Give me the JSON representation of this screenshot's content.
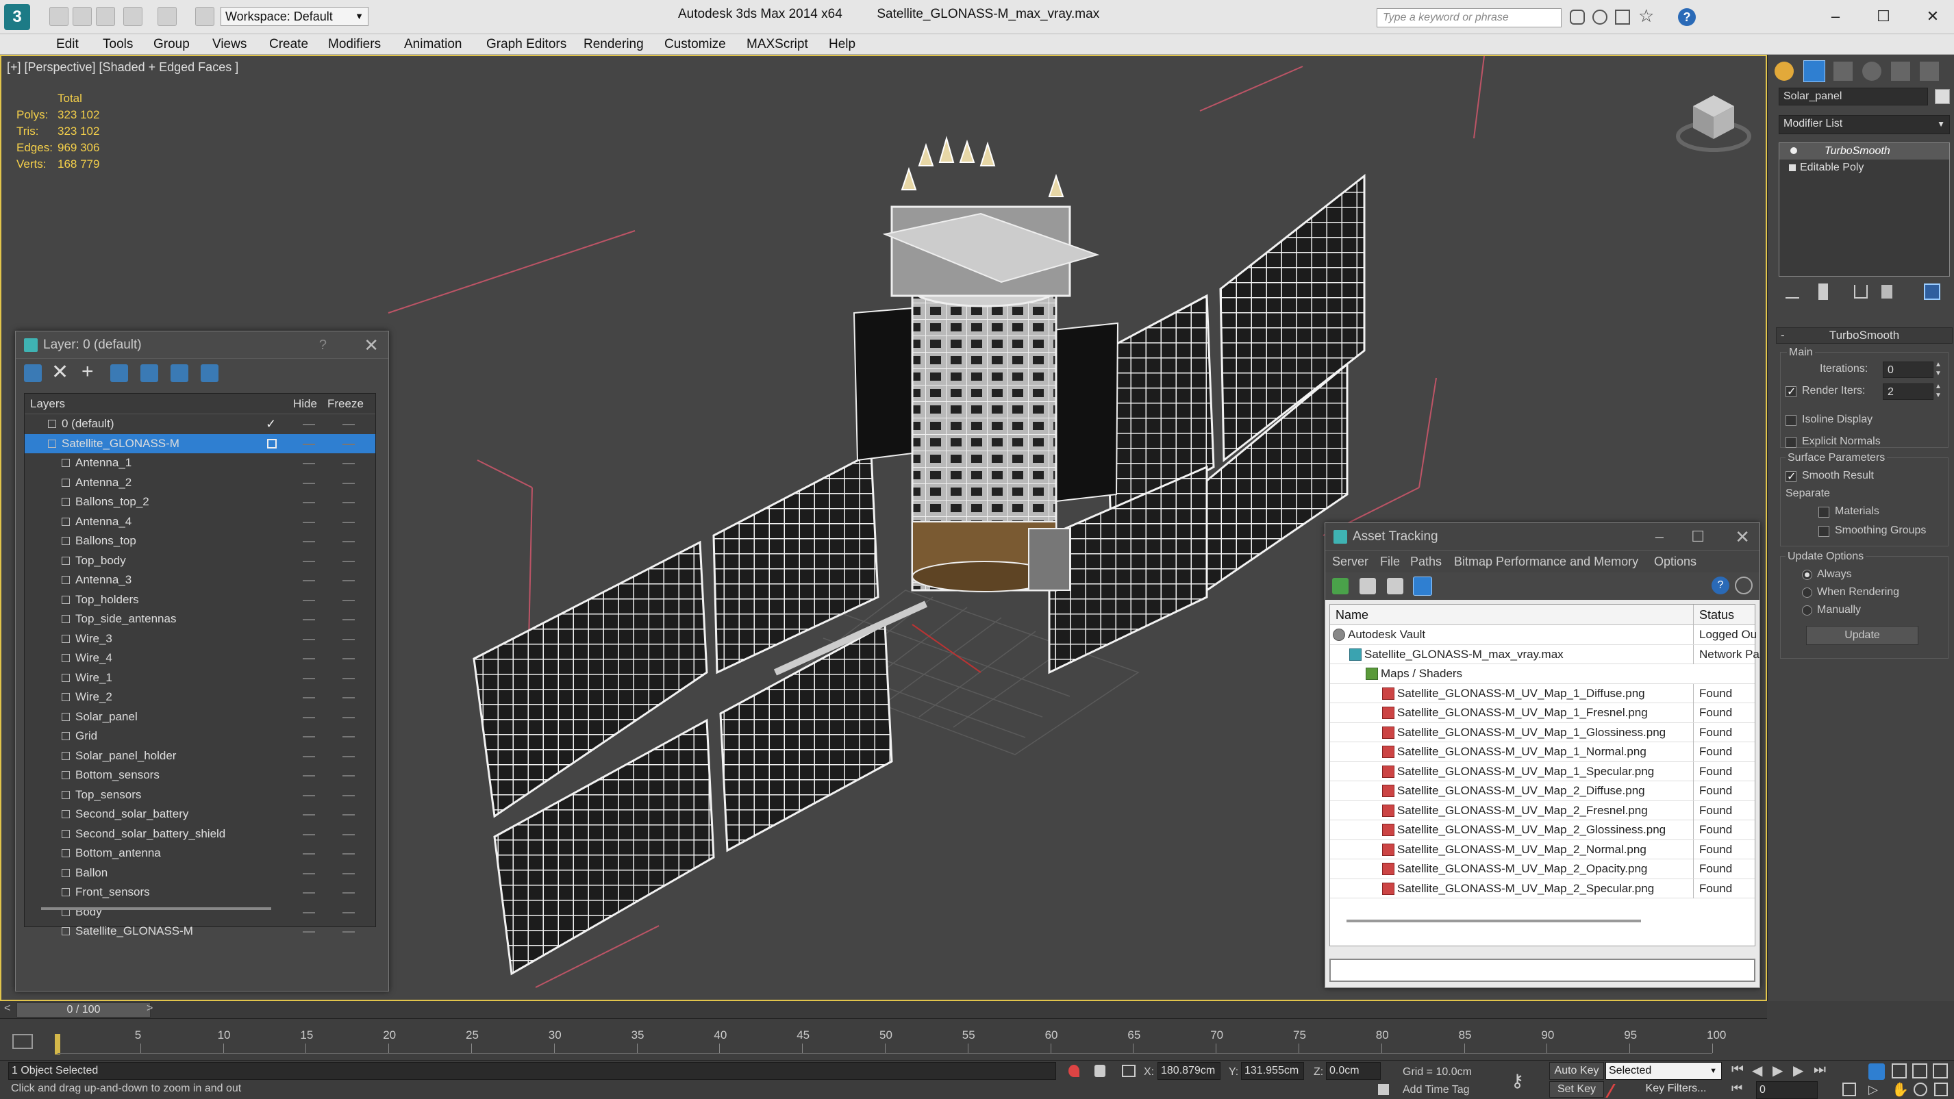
{
  "app": {
    "title": "Autodesk 3ds Max  2014 x64",
    "file": "Satellite_GLONASS-M_max_vray.max",
    "workspace": "Workspace: Default",
    "search_placeholder": "Type a keyword or phrase"
  },
  "menu": [
    "Edit",
    "Tools",
    "Group",
    "Views",
    "Create",
    "Modifiers",
    "Animation",
    "Graph Editors",
    "Rendering",
    "Customize",
    "MAXScript",
    "Help"
  ],
  "viewport": {
    "label": "[+] [Perspective] [Shaded + Edged Faces ]",
    "stats": {
      "header": "Total",
      "rows": [
        {
          "k": "Polys:",
          "v": "323 102"
        },
        {
          "k": "Tris:",
          "v": "323 102"
        },
        {
          "k": "Edges:",
          "v": "969 306"
        },
        {
          "k": "Verts:",
          "v": "168 779"
        }
      ]
    }
  },
  "layer_panel": {
    "title": "Layer: 0 (default)",
    "help": "?",
    "col_layers": "Layers",
    "col_hide": "Hide",
    "col_freeze": "Freeze",
    "layers": [
      {
        "name": "0 (default)",
        "indent": 1,
        "current": true
      },
      {
        "name": "Satellite_GLONASS-M",
        "indent": 1,
        "selected": true
      },
      {
        "name": "Antenna_1",
        "indent": 2
      },
      {
        "name": "Antenna_2",
        "indent": 2
      },
      {
        "name": "Ballons_top_2",
        "indent": 2
      },
      {
        "name": "Antenna_4",
        "indent": 2
      },
      {
        "name": "Ballons_top",
        "indent": 2
      },
      {
        "name": "Top_body",
        "indent": 2
      },
      {
        "name": "Antenna_3",
        "indent": 2
      },
      {
        "name": "Top_holders",
        "indent": 2
      },
      {
        "name": "Top_side_antennas",
        "indent": 2
      },
      {
        "name": "Wire_3",
        "indent": 2
      },
      {
        "name": "Wire_4",
        "indent": 2
      },
      {
        "name": "Wire_1",
        "indent": 2
      },
      {
        "name": "Wire_2",
        "indent": 2
      },
      {
        "name": "Solar_panel",
        "indent": 2
      },
      {
        "name": "Grid",
        "indent": 2
      },
      {
        "name": "Solar_panel_holder",
        "indent": 2
      },
      {
        "name": "Bottom_sensors",
        "indent": 2
      },
      {
        "name": "Top_sensors",
        "indent": 2
      },
      {
        "name": "Second_solar_battery",
        "indent": 2
      },
      {
        "name": "Second_solar_battery_shield",
        "indent": 2
      },
      {
        "name": "Bottom_antenna",
        "indent": 2
      },
      {
        "name": "Ballon",
        "indent": 2
      },
      {
        "name": "Front_sensors",
        "indent": 2
      },
      {
        "name": "Body",
        "indent": 2
      },
      {
        "name": "Satellite_GLONASS-M",
        "indent": 2
      }
    ]
  },
  "asset_panel": {
    "title": "Asset Tracking",
    "menu": [
      "Server",
      "File",
      "Paths",
      "Bitmap Performance and Memory",
      "Options"
    ],
    "col_name": "Name",
    "col_status": "Status",
    "rows": [
      {
        "name": "Autodesk Vault",
        "status": "Logged Ou",
        "indent": 0,
        "kind": "vault"
      },
      {
        "name": "Satellite_GLONASS-M_max_vray.max",
        "status": "Network Pa",
        "indent": 1,
        "kind": "max"
      },
      {
        "name": "Maps / Shaders",
        "status": "",
        "indent": 2,
        "kind": "folder"
      },
      {
        "name": "Satellite_GLONASS-M_UV_Map_1_Diffuse.png",
        "status": "Found",
        "indent": 3,
        "kind": "png"
      },
      {
        "name": "Satellite_GLONASS-M_UV_Map_1_Fresnel.png",
        "status": "Found",
        "indent": 3,
        "kind": "png"
      },
      {
        "name": "Satellite_GLONASS-M_UV_Map_1_Glossiness.png",
        "status": "Found",
        "indent": 3,
        "kind": "png"
      },
      {
        "name": "Satellite_GLONASS-M_UV_Map_1_Normal.png",
        "status": "Found",
        "indent": 3,
        "kind": "png"
      },
      {
        "name": "Satellite_GLONASS-M_UV_Map_1_Specular.png",
        "status": "Found",
        "indent": 3,
        "kind": "png"
      },
      {
        "name": "Satellite_GLONASS-M_UV_Map_2_Diffuse.png",
        "status": "Found",
        "indent": 3,
        "kind": "png"
      },
      {
        "name": "Satellite_GLONASS-M_UV_Map_2_Fresnel.png",
        "status": "Found",
        "indent": 3,
        "kind": "png"
      },
      {
        "name": "Satellite_GLONASS-M_UV_Map_2_Glossiness.png",
        "status": "Found",
        "indent": 3,
        "kind": "png"
      },
      {
        "name": "Satellite_GLONASS-M_UV_Map_2_Normal.png",
        "status": "Found",
        "indent": 3,
        "kind": "png"
      },
      {
        "name": "Satellite_GLONASS-M_UV_Map_2_Opacity.png",
        "status": "Found",
        "indent": 3,
        "kind": "png"
      },
      {
        "name": "Satellite_GLONASS-M_UV_Map_2_Specular.png",
        "status": "Found",
        "indent": 3,
        "kind": "png"
      }
    ]
  },
  "command_panel": {
    "object_name": "Solar_panel",
    "modifier_list": "Modifier List",
    "stack": [
      "TurboSmooth",
      "Editable Poly"
    ],
    "rollout_title": "TurboSmooth",
    "main_label": "Main",
    "iterations_label": "Iterations:",
    "iterations_value": "0",
    "render_iters_label": "Render Iters:",
    "render_iters_value": "2",
    "isoline_label": "Isoline Display",
    "explicit_label": "Explicit Normals",
    "surface_label": "Surface Parameters",
    "smooth_result_label": "Smooth Result",
    "separate_label": "Separate",
    "materials_label": "Materials",
    "smoothing_groups_label": "Smoothing Groups",
    "update_options_label": "Update Options",
    "always_label": "Always",
    "when_rendering_label": "When Rendering",
    "manually_label": "Manually",
    "update_button": "Update"
  },
  "timeline": {
    "frame_counter": "0 / 100",
    "ticks": [
      "5",
      "10",
      "15",
      "20",
      "25",
      "30",
      "35",
      "40",
      "45",
      "50",
      "55",
      "60",
      "65",
      "70",
      "75",
      "80",
      "85",
      "90",
      "95",
      "100"
    ]
  },
  "statusbar": {
    "selection": "1 Object Selected",
    "prompt": "Click and drag up-and-down to zoom in and out",
    "x_label": "X:",
    "x_value": "180.879cm",
    "y_label": "Y:",
    "y_value": "131.955cm",
    "z_label": "Z:",
    "z_value": "0.0cm",
    "grid": "Grid = 10.0cm",
    "auto_key": "Auto Key",
    "set_key": "Set Key",
    "key_mode": "Selected",
    "key_filters": "Key Filters...",
    "add_time_tag": "Add Time Tag",
    "frame_field": "0"
  },
  "colors": {
    "accent_selection": "#2f7fd1",
    "viewport_border": "#e2c54c",
    "stats_text": "#f5d04a",
    "viewport_bg": "#454545"
  }
}
